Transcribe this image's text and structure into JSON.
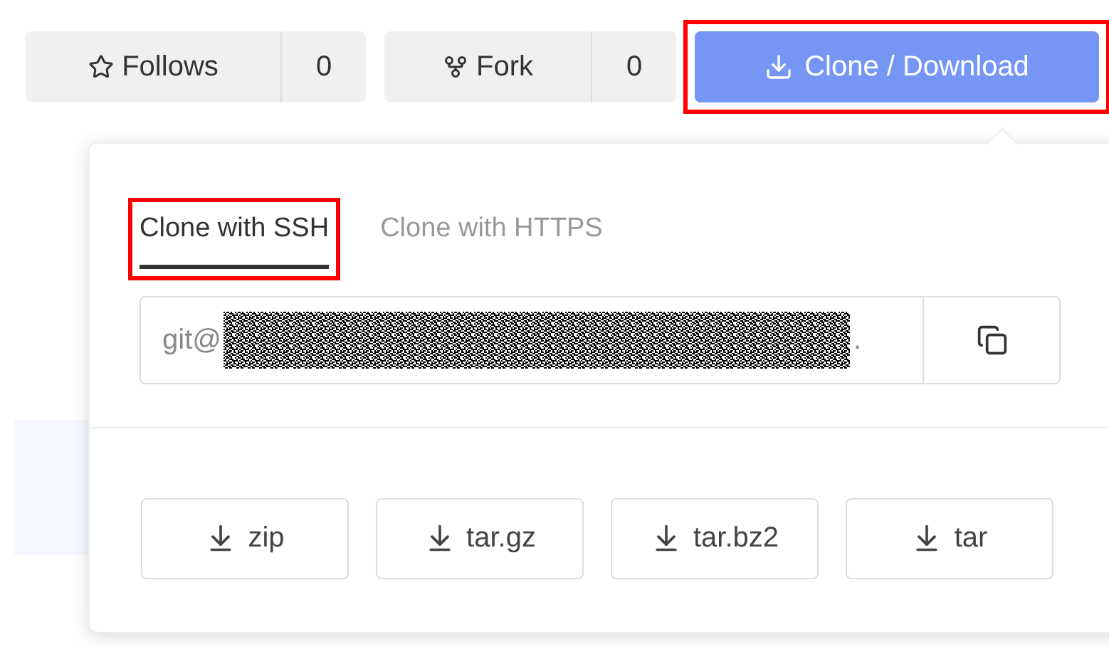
{
  "actions": [
    {
      "kind": "counter",
      "label": "Follows",
      "count": "0"
    },
    {
      "kind": "counter",
      "label": "Fork",
      "count": "0"
    }
  ],
  "clone_button": {
    "label": "Clone / Download",
    "highlighted": true
  },
  "popover": {
    "tabs": [
      {
        "label": "Clone with SSH",
        "selected": true,
        "highlighted": true
      },
      {
        "label": "Clone with HTTPS",
        "selected": false,
        "highlighted": false
      }
    ],
    "url": {
      "prefix": "git@",
      "suffix": "."
    },
    "downloads": [
      {
        "label": "zip"
      },
      {
        "label": "tar.gz"
      },
      {
        "label": "tar.bz2"
      },
      {
        "label": "tar"
      }
    ]
  }
}
